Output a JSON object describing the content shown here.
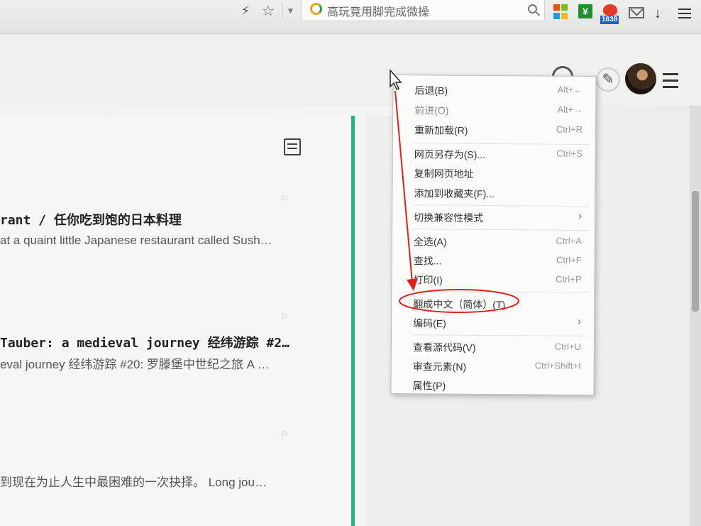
{
  "toolbar": {
    "search": {
      "text": "高玩竟用脚完成微操"
    },
    "weibo_badge": "1638",
    "ext_yen": "¥",
    "icons": [
      "lightning-icon",
      "star-icon",
      "chevron-down-icon",
      "search-icon",
      "windows-icon",
      "yen-icon",
      "weibo-icon",
      "mail-icon",
      "download-icon",
      "menu-icon"
    ]
  },
  "header": {
    "pen_glyph": "✎"
  },
  "posts": [
    {
      "title": "rant / 任你吃到饱的日本料理",
      "excerpt": "at a quaint little Japanese restaurant called Sush…"
    },
    {
      "title": "Tauber: a medieval journey 经纬游踪 #2…",
      "excerpt": "eval journey 经纬游踪 #20: 罗滕堡中世纪之旅 A …"
    },
    {
      "title": "",
      "excerpt": "到现在为止人生中最困难的一次抉择。 Long jou…"
    }
  ],
  "context_menu": {
    "items": [
      {
        "label": "后退(B)",
        "shortcut": "Alt+←",
        "disabled": false
      },
      {
        "label": "前进(O)",
        "shortcut": "Alt+→",
        "disabled": true
      },
      {
        "label": "重新加载(R)",
        "shortcut": "Ctrl+R",
        "disabled": false
      },
      {
        "label": "网页另存为(S)...",
        "shortcut": "Ctrl+S",
        "disabled": false
      },
      {
        "label": "复制网页地址",
        "shortcut": "",
        "disabled": false
      },
      {
        "label": "添加到收藏夹(F)...",
        "shortcut": "",
        "disabled": false
      },
      {
        "label": "切换兼容性模式",
        "shortcut": "",
        "submenu": true,
        "disabled": false
      },
      {
        "label": "全选(A)",
        "shortcut": "Ctrl+A",
        "disabled": false
      },
      {
        "label": "查找...",
        "shortcut": "Ctrl+F",
        "disabled": false
      },
      {
        "label": "打印(I)",
        "shortcut": "Ctrl+P",
        "disabled": false
      },
      {
        "label": "翻成中文（简体）(T)",
        "shortcut": "",
        "disabled": false,
        "highlighted": true
      },
      {
        "label": "编码(E)",
        "shortcut": "",
        "submenu": true,
        "disabled": false
      },
      {
        "label": "查看源代码(V)",
        "shortcut": "Ctrl+U",
        "disabled": false
      },
      {
        "label": "审查元素(N)",
        "shortcut": "Ctrl+Shift+I",
        "disabled": false
      },
      {
        "label": "属性(P)",
        "shortcut": "",
        "disabled": false
      }
    ],
    "submenu_arrow": "›"
  },
  "colors": {
    "accent_green": "#22b588",
    "annotation_red": "#e0201b"
  }
}
